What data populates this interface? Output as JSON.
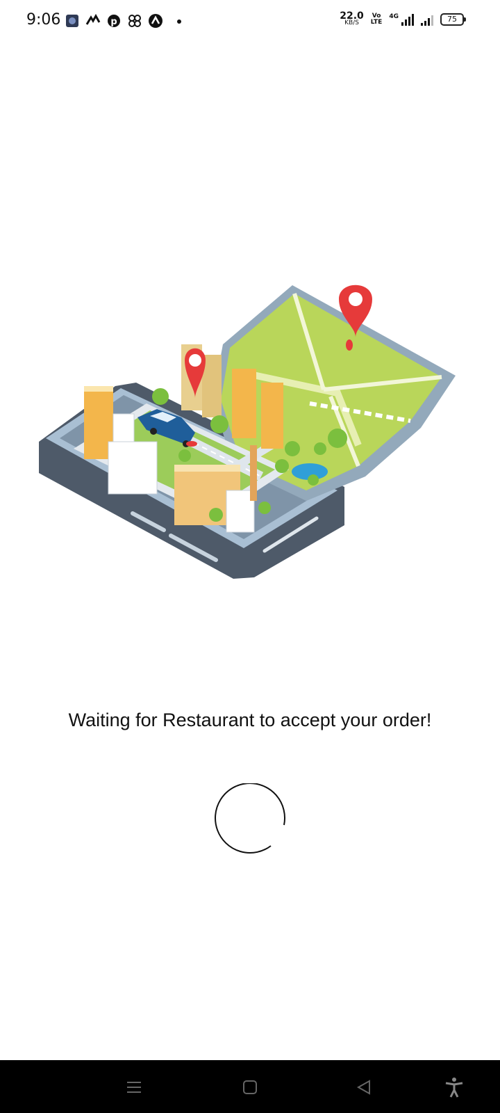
{
  "status_bar": {
    "time": "9:06",
    "net_speed_value": "22.0",
    "net_speed_unit": "KB/S",
    "volte_top": "Vo",
    "volte_bottom": "LTE",
    "network_type": "4G",
    "battery": "75",
    "notification_icons": [
      "gallery-icon",
      "swirl-app-icon",
      "pinterest-icon",
      "pinwheel-icon",
      "caret-app-icon",
      "more-dot-icon"
    ]
  },
  "main": {
    "message": "Waiting for Restaurant to accept your order!"
  },
  "nav_bar": {
    "buttons": [
      "menu-icon",
      "home-icon",
      "back-icon",
      "accessibility-icon"
    ]
  },
  "colors": {
    "map_green": "#b9d65a",
    "pin_red": "#e63a3a",
    "phone_gray": "#5d6a7a",
    "nav_black": "#000000"
  }
}
